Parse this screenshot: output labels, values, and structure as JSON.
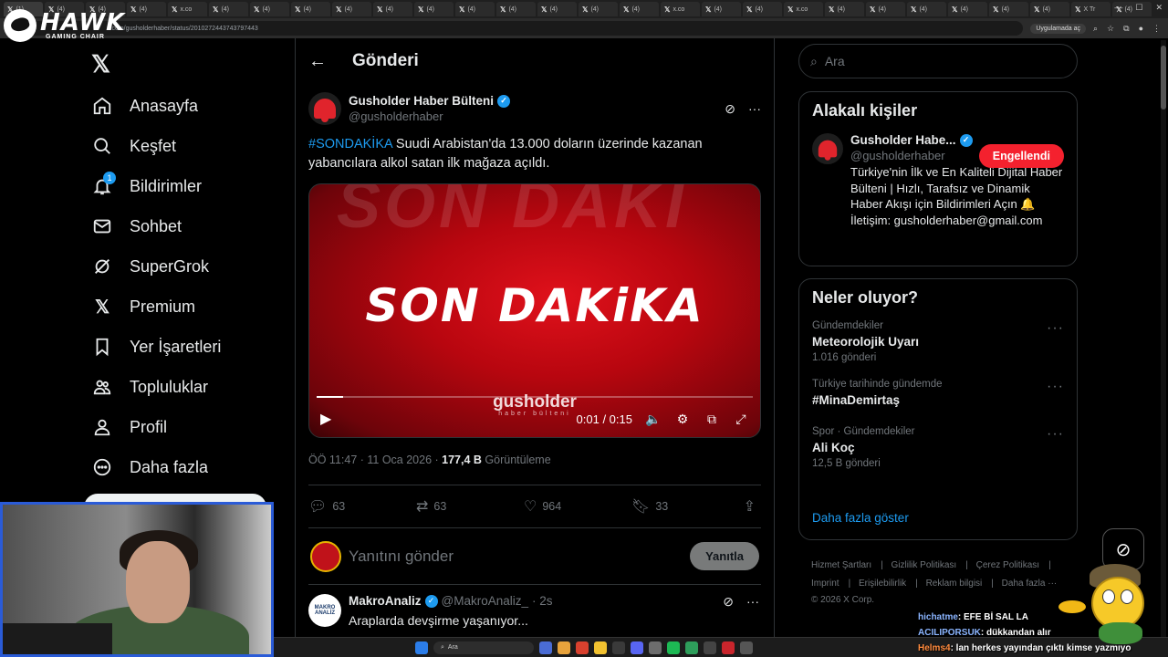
{
  "browser": {
    "url": "x.com/gusholderhaber/status/2010272443743797443",
    "app_pill": "Uygulamada aç",
    "tab_labels": [
      "(1)",
      "(4)",
      "(4)",
      "(4)",
      "x.co",
      "(4)",
      "(4)",
      "(4)",
      "(4)",
      "(4)",
      "(4)",
      "(4)",
      "(4)",
      "(4)",
      "(4)",
      "(4)",
      "x.co",
      "(4)",
      "(4)",
      "x.co",
      "(4)",
      "(4)",
      "(4)",
      "(4)",
      "(4)",
      "(4)",
      "X Tr",
      "(4)"
    ]
  },
  "overlay": {
    "logo_title": "HAWK",
    "logo_sub": "GAMING CHAIR"
  },
  "nav": {
    "items": [
      {
        "label": "Anasayfa",
        "icon": "home-icon"
      },
      {
        "label": "Keşfet",
        "icon": "search-icon"
      },
      {
        "label": "Bildirimler",
        "icon": "bell-icon",
        "badge": "1"
      },
      {
        "label": "Sohbet",
        "icon": "mail-icon"
      },
      {
        "label": "SuperGrok",
        "icon": "grok-icon"
      },
      {
        "label": "Premium",
        "icon": "x-icon"
      },
      {
        "label": "Yer İşaretleri",
        "icon": "bookmark-icon"
      },
      {
        "label": "Topluluklar",
        "icon": "people-icon"
      },
      {
        "label": "Profil",
        "icon": "person-icon"
      },
      {
        "label": "Daha fazla",
        "icon": "more-circle-icon"
      }
    ]
  },
  "main": {
    "title": "Gönderi",
    "post": {
      "author_name": "Gusholder Haber Bülteni",
      "author_handle": "@gusholderhaber",
      "hashtag": "#SONDAKİKA",
      "text": " Suudi Arabistan'da 13.000 doların üzerinde kazanan yabancılara alkol satan ilk mağaza açıldı.",
      "media_bg_text": "SON DAKİ",
      "media_title": "SON DAKiKA",
      "media_brand": "gusholder",
      "media_brand_sub": "haber bülteni",
      "time_display": "0:01 / 0:15",
      "progress": 0.06,
      "timestamp": "ÖÖ 11:47 · 11 Oca 2026 · ",
      "views": "177,4 B",
      "views_label": " Görüntüleme",
      "replies": "63",
      "reposts": "63",
      "likes": "964",
      "bookmarks": "33"
    },
    "reply_placeholder": "Yanıtını gönder",
    "reply_button": "Yanıtla",
    "comment": {
      "avatar_text": "MAKRO ANALİZ",
      "name": "MakroAnaliz",
      "handle": "@MakroAnaliz_",
      "age": "· 2s",
      "text": "Araplarda devşirme yaşanıyor..."
    }
  },
  "sidebar": {
    "search_placeholder": "Ara",
    "related_title": "Alakalı kişiler",
    "related_person": {
      "name": "Gusholder Habe...",
      "handle": "@gusholderhaber",
      "button": "Engellendi",
      "bio": "Türkiye'nin İlk ve En Kaliteli Dijital Haber Bülteni | Hızlı, Tarafsız ve Dinamik Haber Akışı için Bildirimleri Açın 🔔 İletişim: gusholderhaber@gmail.com"
    },
    "trends_title": "Neler oluyor?",
    "trends": [
      {
        "context": "Gündemdekiler",
        "name": "Meteorolojik Uyarı",
        "count": "1.016 gönderi"
      },
      {
        "context": "Türkiye tarihinde gündemde",
        "name": "#MinaDemirtaş",
        "count": ""
      },
      {
        "context": "Spor · Gündemdekiler",
        "name": "Ali Koç",
        "count": "12,5 B gönderi"
      }
    ],
    "show_more": "Daha fazla göster",
    "footer": {
      "line1": [
        "Hizmet Şartları",
        "Gizlilik Politikası",
        "Çerez Politikası"
      ],
      "line2": [
        "Imprint",
        "Erişilebilirlik",
        "Reklam bilgisi",
        "Daha fazla ···"
      ],
      "copyright": "© 2026 X Corp."
    }
  },
  "chat": [
    {
      "user": "hichatme",
      "msg": ": EFE Bİ SAL LA"
    },
    {
      "user": "ACILIPORSUK",
      "msg": ": dükkandan alır"
    },
    {
      "user": "Helms4",
      "msg": ": lan herkes yayından çıktı kimse yazmıyo"
    }
  ],
  "taskbar": {
    "search": "Ara"
  },
  "colors": {
    "accent": "#1d9bf0",
    "danger": "#f4212e",
    "media_red": "#d4101a",
    "background": "#000000",
    "border": "#2f3336"
  }
}
